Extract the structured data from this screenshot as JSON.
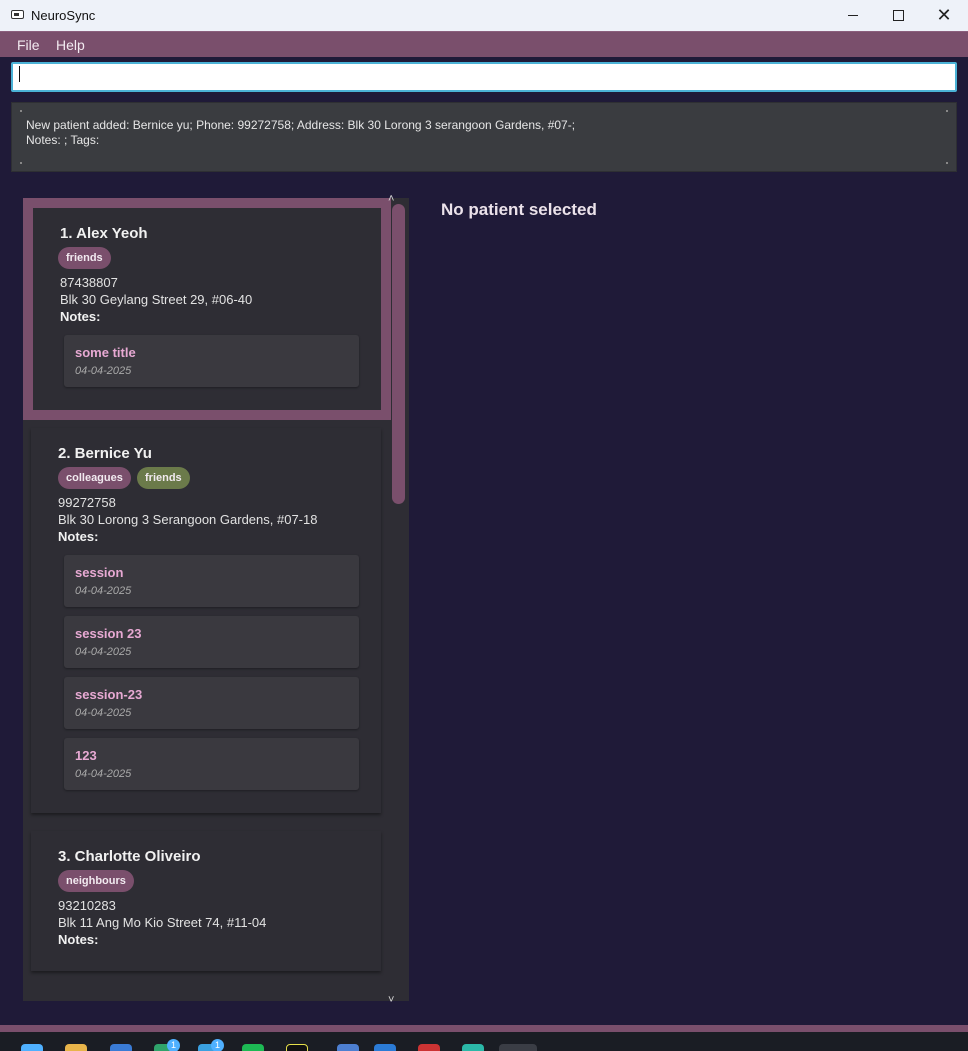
{
  "window": {
    "title": "NeuroSync"
  },
  "menu": {
    "file": "File",
    "help": "Help"
  },
  "command": {
    "value": "",
    "placeholder": ""
  },
  "result": {
    "line1": "New patient added: Bernice yu; Phone: 99272758; Address: Blk 30 Lorong 3 serangoon Gardens, #07-;",
    "line2": "Notes: ; Tags:"
  },
  "patients": [
    {
      "name": "1.  Alex Yeoh",
      "tags": [
        "friends"
      ],
      "phone": "87438807",
      "address": "Blk 30 Geylang Street 29, #06-40",
      "notes_label": "Notes:",
      "notes": [
        {
          "title": "some title",
          "date": "04-04-2025"
        }
      ]
    },
    {
      "name": "2.  Bernice Yu",
      "tags": [
        "colleagues",
        "friends"
      ],
      "phone": "99272758",
      "address": "Blk 30 Lorong 3 Serangoon Gardens, #07-18",
      "notes_label": "Notes:",
      "notes": [
        {
          "title": "session",
          "date": "04-04-2025"
        },
        {
          "title": "session 23",
          "date": "04-04-2025"
        },
        {
          "title": "session-23",
          "date": "04-04-2025"
        },
        {
          "title": "123",
          "date": "04-04-2025"
        }
      ]
    },
    {
      "name": "3.  Charlotte Oliveiro",
      "tags": [
        "neighbours"
      ],
      "phone": "93210283",
      "address": "Blk 11 Ang Mo Kio Street 74, #11-04",
      "notes_label": "Notes:",
      "notes": []
    }
  ],
  "detail": {
    "empty_message": "No patient selected"
  },
  "taskbar": {
    "badge1": "1",
    "badge2": "1"
  },
  "colors": {
    "accent": "#7a4f6c",
    "background": "#1f1a38",
    "card": "#2e2d34",
    "note_title": "#e7a9d3",
    "tag_green": "#6b7a4a",
    "focus": "#4bb2d6"
  }
}
